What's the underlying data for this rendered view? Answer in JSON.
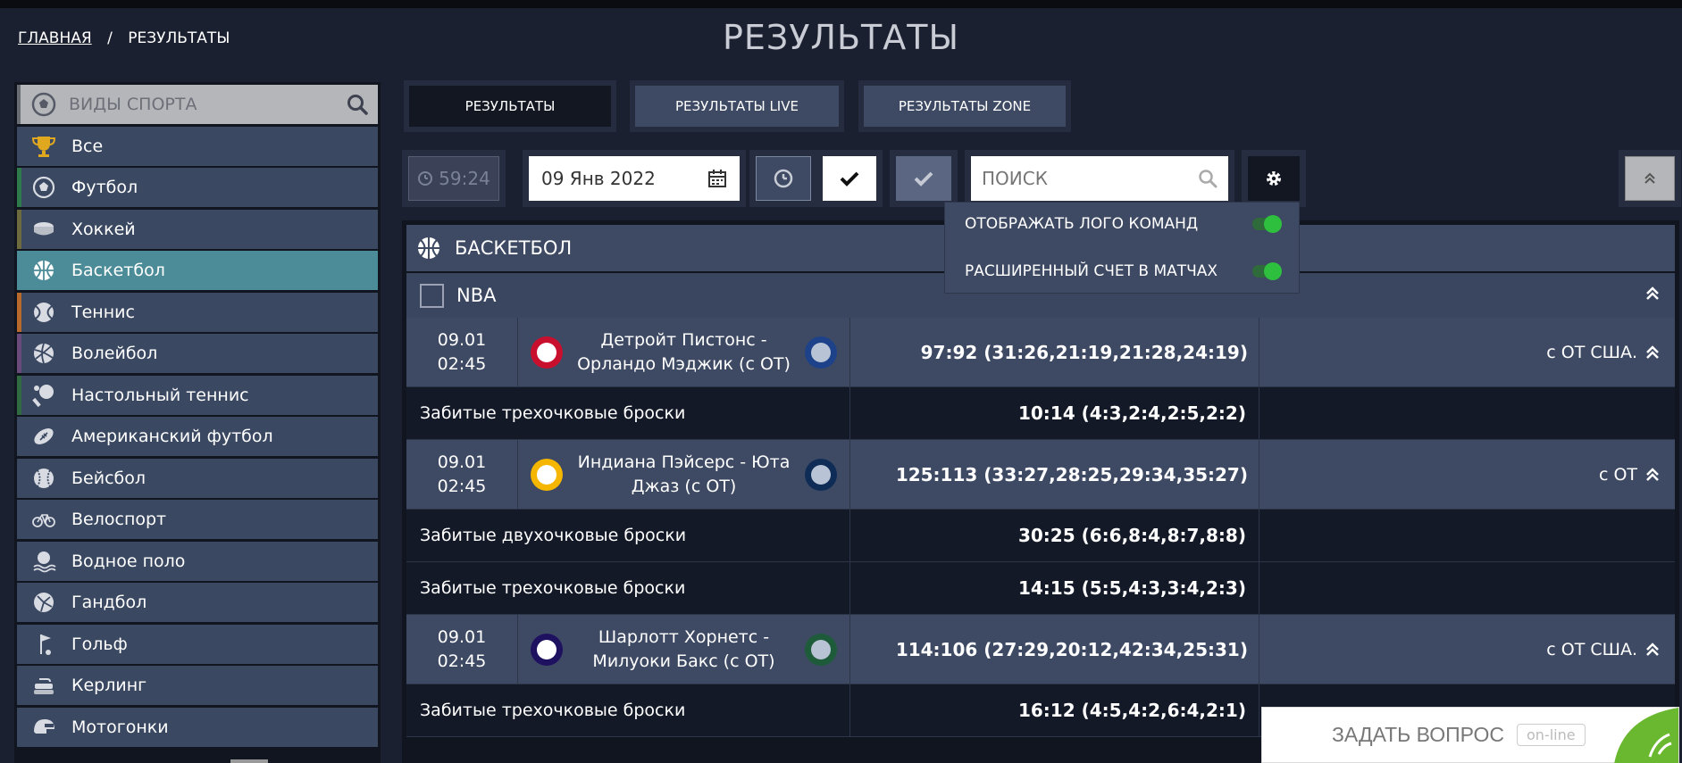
{
  "breadcrumb": {
    "home": "ГЛАВНАЯ",
    "separator": "/",
    "current": "РЕЗУЛЬТАТЫ"
  },
  "page_title": "РЕЗУЛЬТАТЫ",
  "sidebar": {
    "search_label": "ВИДЫ СПОРТА",
    "items": [
      {
        "label": "Все",
        "icon": "trophy-icon",
        "accent": "#3a4862"
      },
      {
        "label": "Футбол",
        "icon": "soccer-ball-icon",
        "accent": "#2e7a4b"
      },
      {
        "label": "Хоккей",
        "icon": "hockey-puck-icon",
        "accent": "#6d6a3e"
      },
      {
        "label": "Баскетбол",
        "icon": "basketball-icon",
        "accent": "#4c8c98",
        "active": true
      },
      {
        "label": "Теннис",
        "icon": "tennis-ball-icon",
        "accent": "#b8692c"
      },
      {
        "label": "Волейбол",
        "icon": "volleyball-icon",
        "accent": "#6a4a7a"
      },
      {
        "label": "Настольный теннис",
        "icon": "table-tennis-icon",
        "accent": "#2f6a40"
      },
      {
        "label": "Американский футбол",
        "icon": "american-football-icon",
        "accent": "#3a4862"
      },
      {
        "label": "Бейсбол",
        "icon": "baseball-icon",
        "accent": "#3a4862"
      },
      {
        "label": "Велоспорт",
        "icon": "bicycle-icon",
        "accent": "#3a4862"
      },
      {
        "label": "Водное поло",
        "icon": "water-polo-icon",
        "accent": "#3a4862"
      },
      {
        "label": "Гандбол",
        "icon": "handball-icon",
        "accent": "#3a4862"
      },
      {
        "label": "Гольф",
        "icon": "golf-icon",
        "accent": "#3a4862"
      },
      {
        "label": "Керлинг",
        "icon": "curling-icon",
        "accent": "#3a4862"
      },
      {
        "label": "Мотогонки",
        "icon": "helmet-icon",
        "accent": "#3a4862"
      }
    ]
  },
  "tabs": [
    {
      "label": "РЕЗУЛЬТАТЫ",
      "active": true
    },
    {
      "label": "РЕЗУЛЬТАТЫ LIVE",
      "active": false
    },
    {
      "label": "РЕЗУЛЬТАТЫ ZONE",
      "active": false
    }
  ],
  "filters": {
    "timer": "59:24",
    "date": "09 Янв 2022",
    "search_placeholder": "ПОИСК"
  },
  "settings": {
    "options": [
      {
        "label": "ОТОБРАЖАТЬ ЛОГО КОМАНД",
        "enabled": true
      },
      {
        "label": "РАСШИРЕННЫЙ СЧЕТ В МАТЧАХ",
        "enabled": true
      }
    ]
  },
  "results": {
    "sport": "БАСКЕТБОЛ",
    "league": "NBA",
    "matches": [
      {
        "date": "09.01",
        "time": "02:45",
        "teams": "Детройт Пистонс - Орландо Мэджик (с ОТ)",
        "score": "97:92 (31:26,21:19,21:28,24:19)",
        "note": "с ОТ США.",
        "stats": [
          {
            "label": "Забитые трехочковые броски",
            "score": "10:14 (4:3,2:4,2:5,2:2)"
          }
        ]
      },
      {
        "date": "09.01",
        "time": "02:45",
        "teams": "Индиана Пэйсерс - Юта Джаз (с ОТ)",
        "score": "125:113 (33:27,28:25,29:34,35:27)",
        "note": "с ОТ",
        "stats": [
          {
            "label": "Забитые двухочковые броски",
            "score": "30:25 (6:6,8:4,8:7,8:8)"
          },
          {
            "label": "Забитые трехочковые броски",
            "score": "14:15 (5:5,4:3,3:4,2:3)"
          }
        ]
      },
      {
        "date": "09.01",
        "time": "02:45",
        "teams": "Шарлотт Хорнетс - Милуоки Бакс (с ОТ)",
        "score": "114:106 (27:29,20:12,42:34,25:31)",
        "note": "с ОТ США.",
        "stats": [
          {
            "label": "Забитые трехочковые броски",
            "score": "16:12 (4:5,4:2,6:4,2:1)"
          }
        ]
      }
    ]
  },
  "chat": {
    "label": "ЗАДАТЬ ВОПРОС",
    "status": "on-line"
  },
  "colors": {
    "accent_green": "#2fbf3f",
    "panel": "#3e4a63",
    "active": "#4c8c98"
  }
}
